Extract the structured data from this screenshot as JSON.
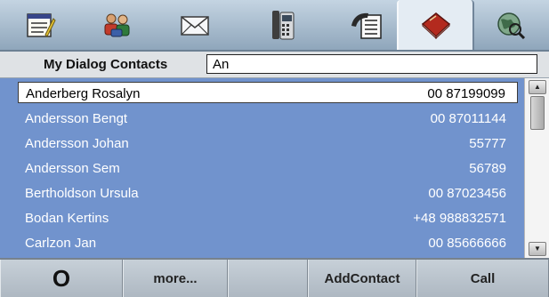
{
  "tabs": [
    {
      "icon": "notepad-icon"
    },
    {
      "icon": "people-icon"
    },
    {
      "icon": "envelope-icon"
    },
    {
      "icon": "phone-icon"
    },
    {
      "icon": "call-list-icon"
    },
    {
      "icon": "phonebook-icon",
      "active": true
    },
    {
      "icon": "globe-icon"
    }
  ],
  "search": {
    "label": "My Dialog Contacts",
    "value": "An"
  },
  "contacts": [
    {
      "name": "Anderberg Rosalyn",
      "phone": "00 87199099",
      "selected": true
    },
    {
      "name": "Andersson Bengt",
      "phone": "00 87011144"
    },
    {
      "name": "Andersson Johan",
      "phone": "55777"
    },
    {
      "name": "Andersson Sem",
      "phone": "56789"
    },
    {
      "name": "Bertholdson Ursula",
      "phone": "00 87023456"
    },
    {
      "name": "Bodan Kertins",
      "phone": "+48 988832571"
    },
    {
      "name": "Carlzon Jan",
      "phone": "00 85666666"
    }
  ],
  "softkeys": {
    "k1": "O",
    "k2": "more...",
    "k3": "",
    "k4": "AddContact",
    "k5": "Call"
  },
  "colors": {
    "list_bg": "#7193cd",
    "tabbar": "#a9bccd",
    "softkey_bg": "#b9c3cc"
  }
}
